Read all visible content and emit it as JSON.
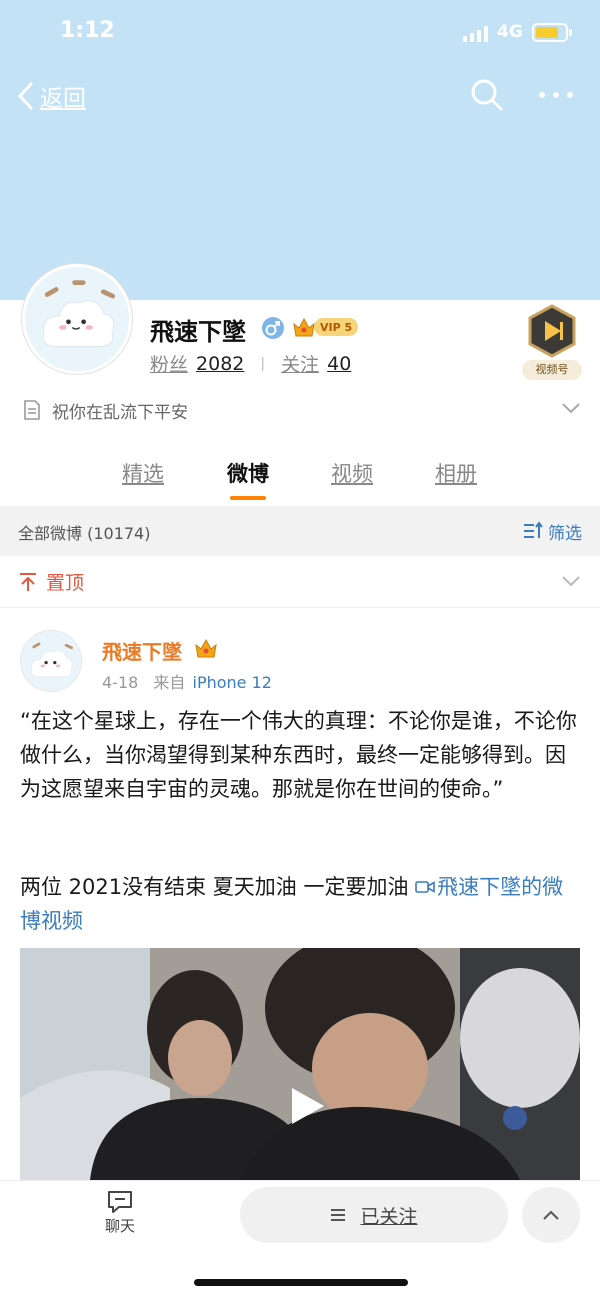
{
  "status_bar": {
    "time": "1:12",
    "network": "4G"
  },
  "nav": {
    "back_label": "返回"
  },
  "profile": {
    "name": "飛速下墜",
    "vip_label": "VIP 5",
    "followers_label": "粉丝",
    "followers_count": "2082",
    "following_label": "关注",
    "following_count": "40",
    "video_badge_label": "视频号",
    "bio": "祝你在乱流下平安"
  },
  "tabs": [
    {
      "label": "精选"
    },
    {
      "label": "微博"
    },
    {
      "label": "视频"
    },
    {
      "label": "相册"
    }
  ],
  "feed": {
    "count_label": "全部微博 (10174)",
    "filter_label": "筛选",
    "pinned_label": "置顶"
  },
  "post": {
    "author": "飛速下墜",
    "date": "4-18",
    "source_prefix": "来自",
    "source": "iPhone 12",
    "text_quote": "“在这个星球上，存在一个伟大的真理：不论你是谁，不论你做什么，当你渴望得到某种东西时，最终一定能够得到。因为这愿望来自宇宙的灵魂。那就是你在世间的使命。”",
    "text_line": "两位 2021没有结束 夏天加油 一定要加油 ",
    "video_link": "飛速下墜的微博视频"
  },
  "bottom_bar": {
    "chat_label": "聊天",
    "follow_label": "已关注"
  },
  "colors": {
    "accent_orange": "#ff8200",
    "link_blue": "#3a7cc2",
    "pinned_red": "#e5563f",
    "cover_blue": "#c3e2f5"
  }
}
